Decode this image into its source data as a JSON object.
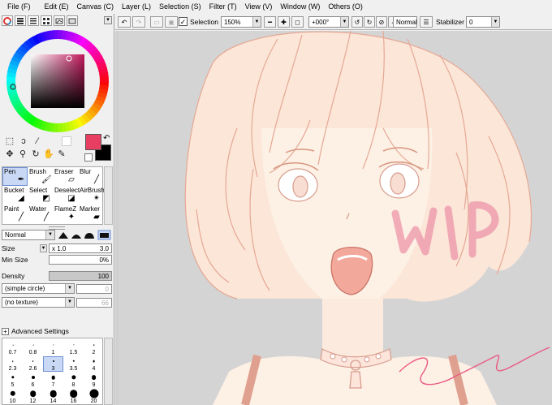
{
  "menu": [
    "File (F)",
    "Edit (E)",
    "Canvas (C)",
    "Layer (L)",
    "Selection (S)",
    "Filter (T)",
    "View (V)",
    "Window (W)",
    "Others (O)"
  ],
  "toolbar": {
    "selection_label": "Selection",
    "selection_checked": true,
    "zoom": "150%",
    "rotation": "+000°",
    "blend": "Normal",
    "stabilizer_label": "Stabilizer",
    "stabilizer_value": "0"
  },
  "color": {
    "primary": "#e83e62",
    "secondary": "#000000",
    "icons": [
      "rect-select-icon",
      "lasso-icon",
      "magic-wand-icon",
      "move-icon",
      "zoom-icon",
      "rotate-icon",
      "hand-icon",
      "eyedropper-icon"
    ]
  },
  "brush_tools": [
    {
      "label": "Pen",
      "icon": "pen-icon",
      "selected": true
    },
    {
      "label": "Brush",
      "icon": "brush-icon"
    },
    {
      "label": "Eraser",
      "icon": "eraser-icon"
    },
    {
      "label": "Blur",
      "icon": "blur-icon"
    },
    {
      "label": "Bucket",
      "icon": "bucket-icon"
    },
    {
      "label": "Select",
      "icon": "select-icon"
    },
    {
      "label": "Deselect",
      "icon": "deselect-icon"
    },
    {
      "label": "AirBrush",
      "icon": "airbrush-icon"
    },
    {
      "label": "Paint",
      "icon": "paint-icon"
    },
    {
      "label": "Water",
      "icon": "water-icon"
    },
    {
      "label": "FlameZ",
      "icon": "flame-icon"
    },
    {
      "label": "Marker",
      "icon": "marker-icon"
    }
  ],
  "brush_settings": {
    "blend_mode": "Normal",
    "size_label": "Size",
    "size_multiplier": "x 1.0",
    "size_value": "3.0",
    "min_size_label": "Min Size",
    "min_size_value": "0%",
    "density_label": "Density",
    "density_value": "100",
    "shape": "(simple circle)",
    "shape_value": "0",
    "texture": "(no texture)",
    "texture_value": "66",
    "advanced_label": "Advanced Settings"
  },
  "size_presets": [
    {
      "label": "0.7",
      "d": 0.6
    },
    {
      "label": "0.8",
      "d": 0.7
    },
    {
      "label": "1",
      "d": 1
    },
    {
      "label": "1.5",
      "d": 1.2
    },
    {
      "label": "2",
      "d": 1.5
    },
    {
      "label": "2.3",
      "d": 1.6
    },
    {
      "label": "2.6",
      "d": 1.8
    },
    {
      "label": "3",
      "d": 2,
      "selected": true
    },
    {
      "label": "3.5",
      "d": 2.4
    },
    {
      "label": "4",
      "d": 2.8
    },
    {
      "label": "5",
      "d": 3.4
    },
    {
      "label": "6",
      "d": 4
    },
    {
      "label": "7",
      "d": 4.6
    },
    {
      "label": "8",
      "d": 5.2
    },
    {
      "label": "9",
      "d": 5.8
    },
    {
      "label": "10",
      "d": 6.4
    },
    {
      "label": "12",
      "d": 7.6
    },
    {
      "label": "14",
      "d": 8.6
    },
    {
      "label": "16",
      "d": 9.6
    },
    {
      "label": "20",
      "d": 11
    }
  ],
  "artwork": {
    "watermark_text": "WIP",
    "signature_text": "Sha..."
  }
}
